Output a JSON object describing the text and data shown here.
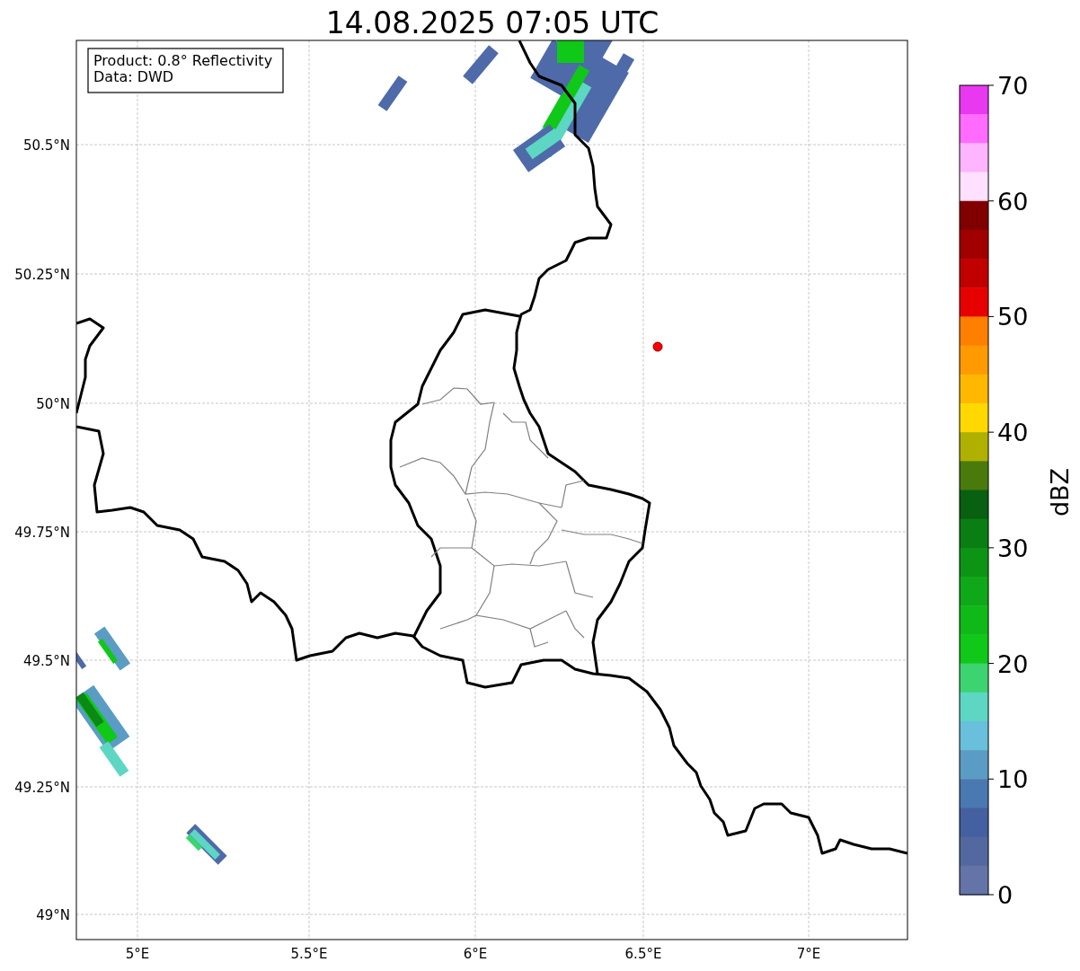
{
  "title": "14.08.2025 07:05 UTC",
  "info_box": [
    "Product: 0.8° Reflectivity",
    "Data: DWD"
  ],
  "map": {
    "lat_ticks": [
      "50.5°N",
      "50.25°N",
      "50°N",
      "49.75°N",
      "49.5°N",
      "49.25°N",
      "49°N"
    ],
    "lon_ticks": [
      "5°E",
      "5.5°E",
      "6°E",
      "6.5°E",
      "7°E"
    ]
  },
  "colorbar": {
    "label": "dBZ",
    "ticks": [
      "70",
      "60",
      "50",
      "40",
      "30",
      "20",
      "10",
      "0"
    ],
    "bins": [
      {
        "color": "#e838f0"
      },
      {
        "color": "#ff6cff"
      },
      {
        "color": "#ffb4ff"
      },
      {
        "color": "#ffe0ff"
      },
      {
        "color": "#800000"
      },
      {
        "color": "#a00000"
      },
      {
        "color": "#c00000"
      },
      {
        "color": "#e60000"
      },
      {
        "color": "#ff7f00"
      },
      {
        "color": "#ff9a00"
      },
      {
        "color": "#ffb800"
      },
      {
        "color": "#ffd800"
      },
      {
        "color": "#b0b000"
      },
      {
        "color": "#4a7a0c"
      },
      {
        "color": "#086010"
      },
      {
        "color": "#0a7e12"
      },
      {
        "color": "#0c9414"
      },
      {
        "color": "#0ea818"
      },
      {
        "color": "#0fba18"
      },
      {
        "color": "#10c818"
      },
      {
        "color": "#3cd470"
      },
      {
        "color": "#5ed6c4"
      },
      {
        "color": "#68c0dc"
      },
      {
        "color": "#5a9cc4"
      },
      {
        "color": "#4a78b0"
      },
      {
        "color": "#4460a0"
      },
      {
        "color": "#5468a0"
      },
      {
        "color": "#6474a8"
      }
    ]
  }
}
